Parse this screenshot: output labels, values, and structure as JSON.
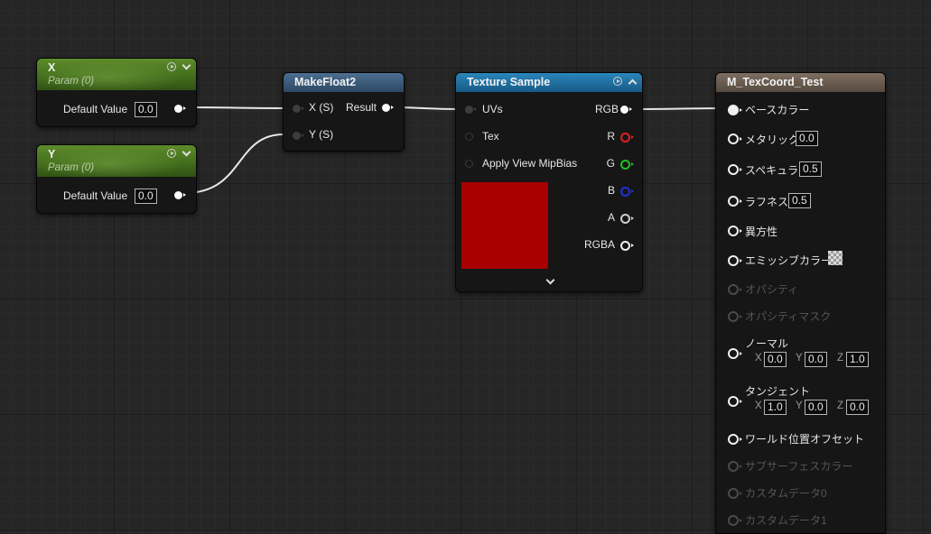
{
  "nodes": {
    "param_x": {
      "title": "X",
      "subtitle": "Param (0)",
      "field_label": "Default Value",
      "value": "0.0"
    },
    "param_y": {
      "title": "Y",
      "subtitle": "Param (0)",
      "field_label": "Default Value",
      "value": "0.0"
    },
    "makefloat2": {
      "title": "MakeFloat2",
      "in_x": "X (S)",
      "in_y": "Y (S)",
      "out": "Result"
    },
    "texture_sample": {
      "title": "Texture Sample",
      "inputs": [
        "UVs",
        "Tex",
        "Apply View MipBias"
      ],
      "outputs": [
        "RGB",
        "R",
        "G",
        "B",
        "A",
        "RGBA"
      ],
      "preview_color": "#a80000"
    },
    "material": {
      "title": "M_TexCoord_Test",
      "pins": {
        "base_color": "ベースカラー",
        "metallic": "メタリック",
        "metallic_val": "0.0",
        "specular": "スペキュラ",
        "specular_val": "0.5",
        "roughness": "ラフネス",
        "roughness_val": "0.5",
        "anisotropy": "異方性",
        "emissive": "エミッシブカラー",
        "opacity": "オパシティ",
        "opacity_mask": "オパシティマスク",
        "normal": "ノーマル",
        "normal_x": "0.0",
        "normal_y": "0.0",
        "normal_z": "1.0",
        "tangent": "タンジェント",
        "tangent_x": "1.0",
        "tangent_y": "0.0",
        "tangent_z": "0.0",
        "wpo": "ワールド位置オフセット",
        "subsurface": "サブサーフェスカラー",
        "custom0": "カスタムデータ0",
        "custom1": "カスタムデータ1"
      },
      "axis_x": "X",
      "axis_y": "Y",
      "axis_z": "Z"
    }
  },
  "colors": {
    "param_header": "#4d7c24",
    "makefloat_header": "#3d5a7a",
    "texture_header": "#1f6f9e",
    "material_header": "#6a5d50",
    "pin_r": "#e02020",
    "pin_g": "#20c020",
    "pin_b": "#2030e0"
  }
}
